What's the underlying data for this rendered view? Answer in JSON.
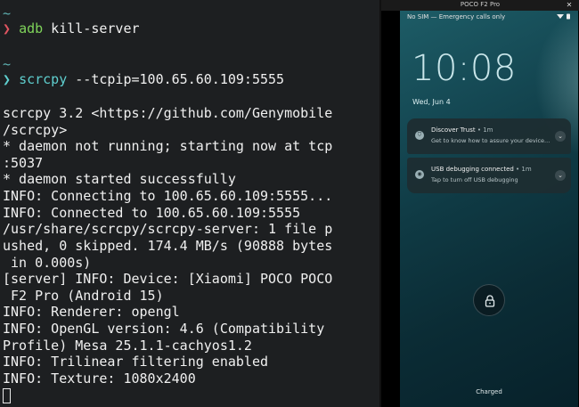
{
  "terminal": {
    "prompt_tilde": "~",
    "prompt_arrow": "❯",
    "cmd1_name": "adb",
    "cmd1_args": " kill-server",
    "cmd2_name": "scrcpy",
    "cmd2_args": " --tcpip=100.65.60.109:5555",
    "output": [
      "scrcpy 3.2 <https://github.com/Genymobile",
      "/scrcpy>",
      "* daemon not running; starting now at tcp",
      ":5037",
      "* daemon started successfully",
      "INFO: Connecting to 100.65.60.109:5555...",
      "INFO: Connected to 100.65.60.109:5555",
      "/usr/share/scrcpy/scrcpy-server: 1 file p",
      "ushed, 0 skipped. 174.4 MB/s (90888 bytes",
      " in 0.000s)",
      "[server] INFO: Device: [Xiaomi] POCO POCO",
      " F2 Pro (Android 15)",
      "INFO: Renderer: opengl",
      "INFO: OpenGL version: 4.6 (Compatibility",
      "Profile) Mesa 25.1.1-cachyos1.2",
      "INFO: Trilinear filtering enabled",
      "INFO: Texture: 1080x2400"
    ]
  },
  "window": {
    "title": "POCO F2 Pro",
    "close_icon": "close-icon"
  },
  "phone": {
    "status_text": "No SIM — Emergency calls only",
    "status_icons": "▾ ▮",
    "clock": "10:08",
    "date": "Wed, Jun 4",
    "notifications": [
      {
        "title": "Discover Trust",
        "time": " • 1m",
        "text": "Get to know how to assure your device...",
        "icon": "shield-icon"
      },
      {
        "title": "USB debugging connected",
        "time": " • 1m",
        "text": "Tap to turn off USB debugging",
        "icon": "usb-icon"
      }
    ],
    "charged": "Charged"
  }
}
